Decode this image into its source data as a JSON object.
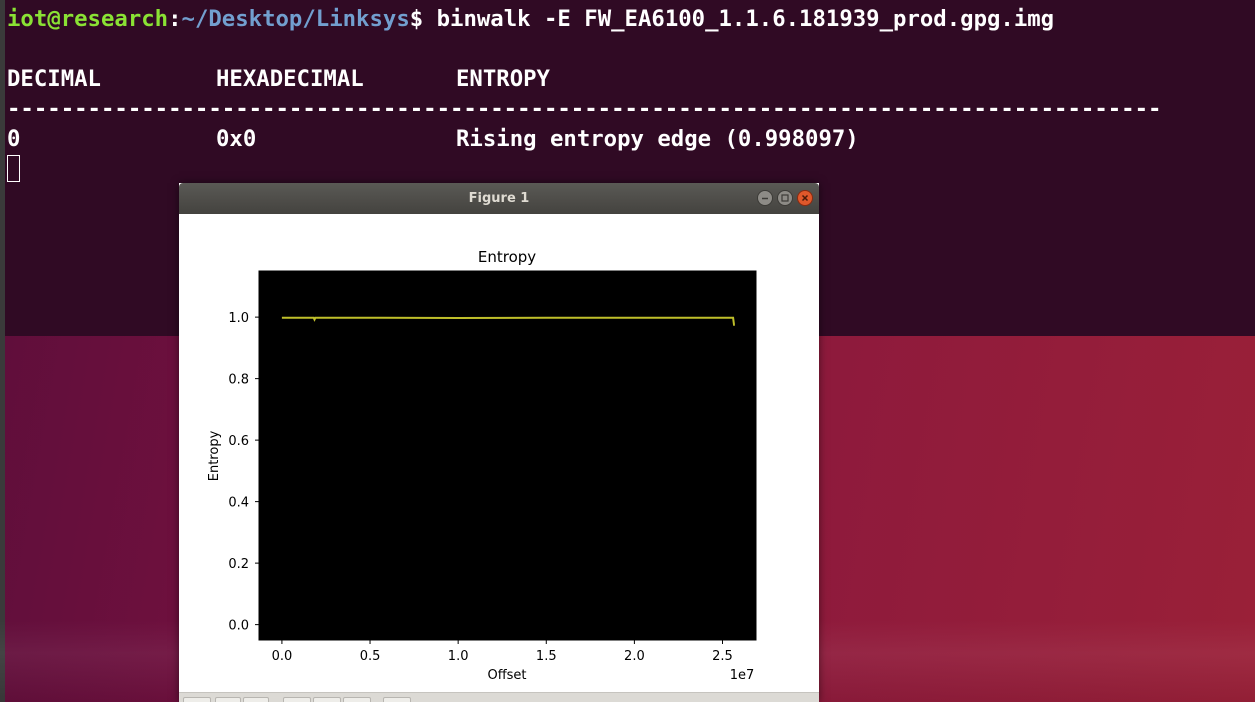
{
  "terminal": {
    "prompt_user": "iot@research",
    "prompt_sep": ":",
    "prompt_path": "~/Desktop/Linksys",
    "prompt_end": "$ ",
    "command": "binwalk -E FW_EA6100_1.1.6.181939_prod.gpg.img",
    "headers": [
      "DECIMAL",
      "HEXADECIMAL",
      "ENTROPY"
    ],
    "separator": "--------------------------------------------------------------------------------------",
    "rows": [
      {
        "decimal": "0",
        "hex": "0x0",
        "description": "Rising entropy edge (0.998097)"
      }
    ]
  },
  "window": {
    "title": "Figure 1"
  },
  "colors": {
    "terminal_bg": "#300a24",
    "prompt_user": "#8ae234",
    "prompt_path": "#729fcf",
    "plot_bg": "#000000",
    "line": "#bfbf2a"
  },
  "chart_data": {
    "type": "line",
    "title": "Entropy",
    "xlabel": "Offset",
    "ylabel": "Entropy",
    "x_offset_label": "1e7",
    "xlim": [
      -0.13,
      2.69
    ],
    "ylim": [
      -0.05,
      1.15
    ],
    "xticks": [
      0.0,
      0.5,
      1.0,
      1.5,
      2.0,
      2.5
    ],
    "xtick_labels": [
      "0.0",
      "0.5",
      "1.0",
      "1.5",
      "2.0",
      "2.5"
    ],
    "yticks": [
      0.0,
      0.2,
      0.4,
      0.6,
      0.8,
      1.0
    ],
    "ytick_labels": [
      "0.0",
      "0.2",
      "0.4",
      "0.6",
      "0.8",
      "1.0"
    ],
    "grid": false,
    "series": [
      {
        "x": [
          0.0,
          0.18,
          0.185,
          0.19,
          0.5,
          1.0,
          1.5,
          2.0,
          2.5,
          2.56,
          2.565,
          2.57
        ],
        "y": [
          0.998,
          0.998,
          0.992,
          0.998,
          0.998,
          0.997,
          0.998,
          0.998,
          0.998,
          0.998,
          0.975,
          0.975
        ]
      }
    ]
  }
}
